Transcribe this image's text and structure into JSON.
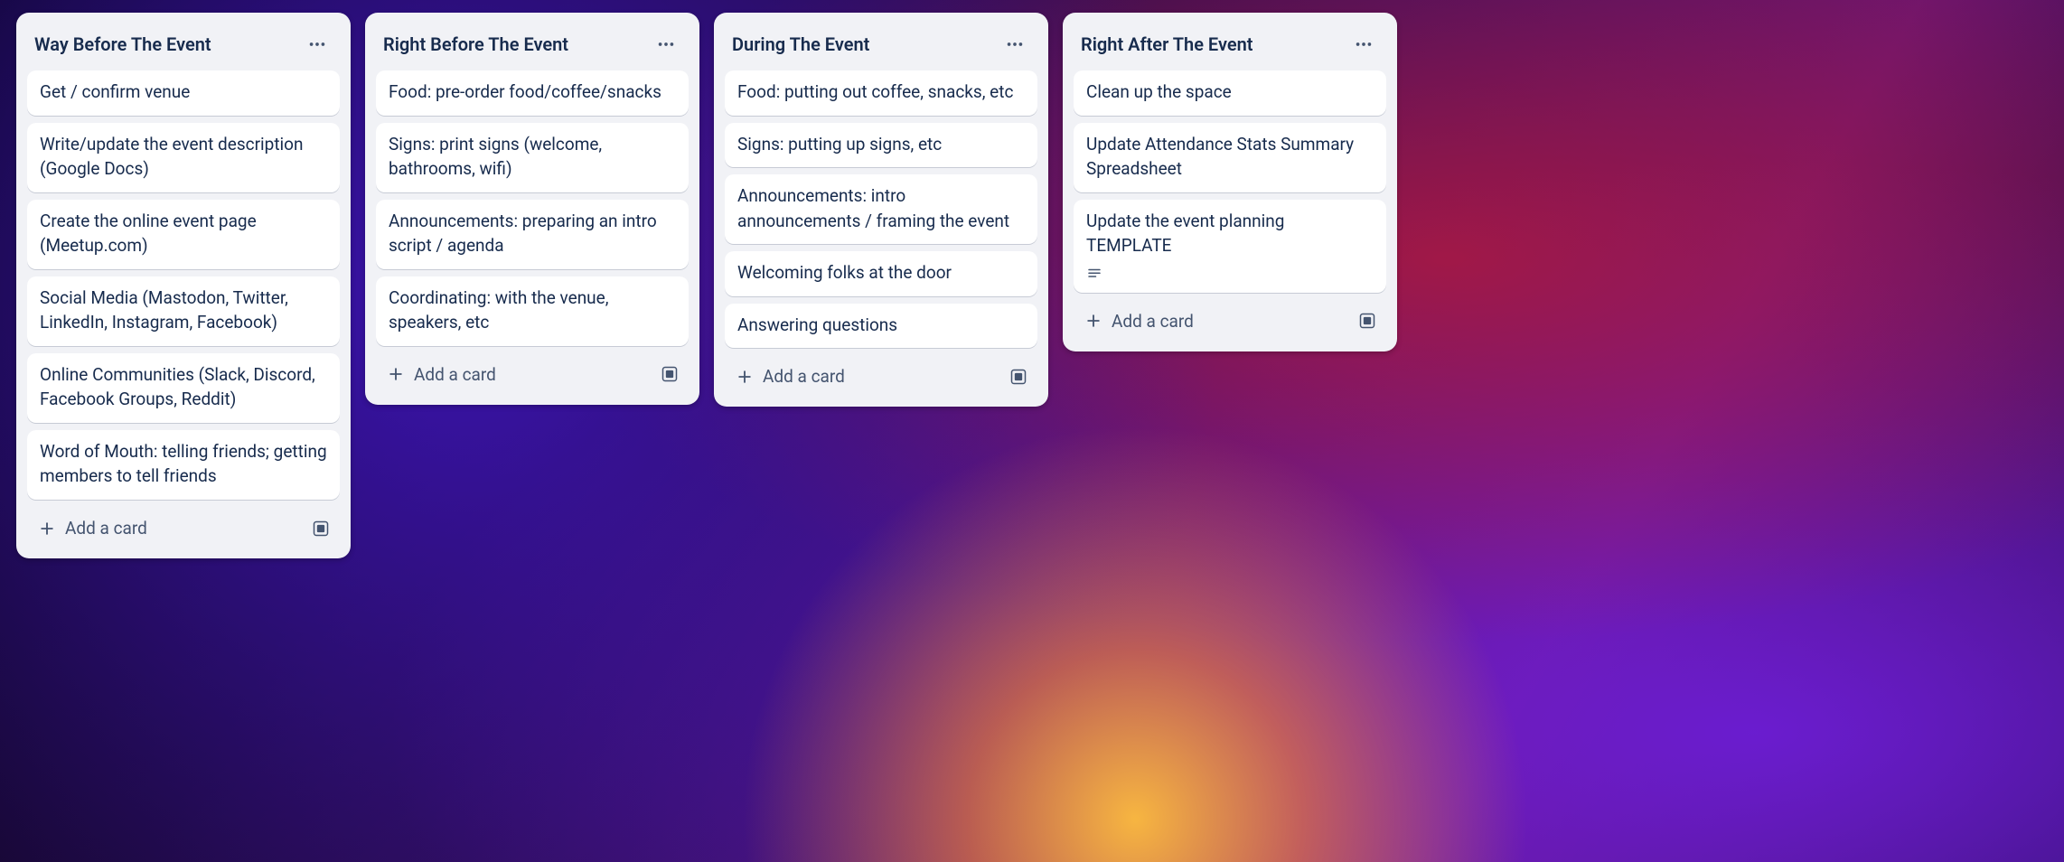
{
  "ui": {
    "add_card_label": "Add a card"
  },
  "lists": [
    {
      "title": "Way Before The Event",
      "cards": [
        {
          "text": "Get / confirm venue",
          "has_description": false
        },
        {
          "text": "Write/update the event description (Google Docs)",
          "has_description": false
        },
        {
          "text": "Create the online event page (Meetup.com)",
          "has_description": false
        },
        {
          "text": "Social Media (Mastodon, Twitter, LinkedIn, Instagram, Facebook)",
          "has_description": false
        },
        {
          "text": "Online Communities (Slack, Discord, Facebook Groups, Reddit)",
          "has_description": false
        },
        {
          "text": "Word of Mouth: telling friends; getting members to tell friends",
          "has_description": false
        }
      ]
    },
    {
      "title": "Right Before The Event",
      "cards": [
        {
          "text": "Food: pre-order food/coffee/snacks",
          "has_description": false
        },
        {
          "text": "Signs: print signs (welcome, bathrooms, wifi)",
          "has_description": false
        },
        {
          "text": "Announcements: preparing an intro script / agenda",
          "has_description": false
        },
        {
          "text": "Coordinating: with the venue, speakers, etc",
          "has_description": false
        }
      ]
    },
    {
      "title": "During The Event",
      "cards": [
        {
          "text": "Food: putting out coffee, snacks, etc",
          "has_description": false
        },
        {
          "text": "Signs: putting up signs, etc",
          "has_description": false
        },
        {
          "text": "Announcements: intro announcements / framing the event",
          "has_description": false
        },
        {
          "text": "Welcoming folks at the door",
          "has_description": false
        },
        {
          "text": "Answering questions",
          "has_description": false
        }
      ]
    },
    {
      "title": "Right After The Event",
      "cards": [
        {
          "text": "Clean up the space",
          "has_description": false
        },
        {
          "text": "Update Attendance Stats Summary Spreadsheet",
          "has_description": false
        },
        {
          "text": "Update the event planning TEMPLATE",
          "has_description": true
        }
      ]
    }
  ]
}
